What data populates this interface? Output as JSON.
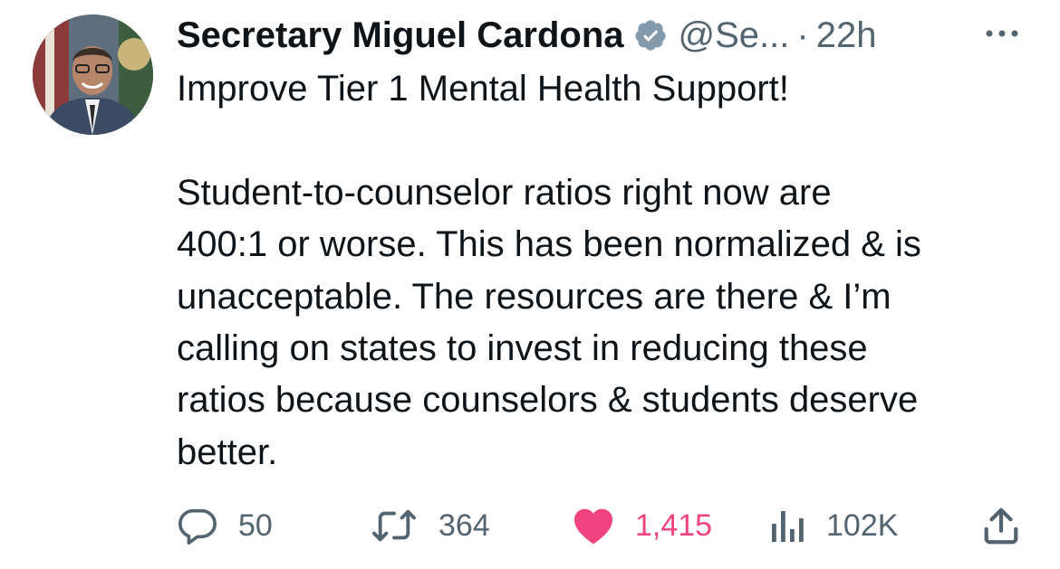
{
  "tweet": {
    "author_name": "Secretary Miguel Cardona",
    "handle": "@Se...",
    "separator": "·",
    "time": "22h",
    "avatar_icon": "person-avatar",
    "verified_icon": "verified-badge-icon",
    "lines": [
      "Improve Tier 1 Mental Health Support!",
      "",
      "Student-to-counselor ratios right now are",
      "400:1 or worse. This has been normalized & is",
      "unacceptable. The resources are there & I’m",
      "calling on states to invest in reducing these",
      "ratios because counselors & students deserve",
      "better."
    ]
  },
  "actions": {
    "replies": "50",
    "retweets": "364",
    "likes": "1,415",
    "views": "102K"
  },
  "colors": {
    "text": "#0f1419",
    "muted": "#536471",
    "like": "#f0437f",
    "verified": "#829aab"
  }
}
